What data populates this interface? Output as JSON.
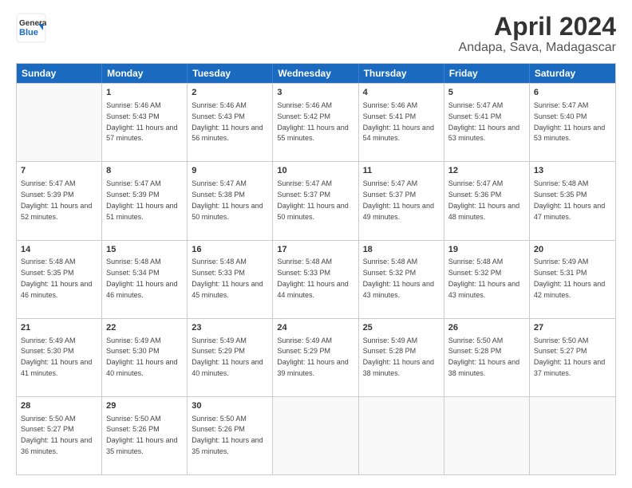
{
  "header": {
    "logo_general": "General",
    "logo_blue": "Blue",
    "month": "April 2024",
    "location": "Andapa, Sava, Madagascar"
  },
  "days_of_week": [
    "Sunday",
    "Monday",
    "Tuesday",
    "Wednesday",
    "Thursday",
    "Friday",
    "Saturday"
  ],
  "weeks": [
    [
      {
        "day": "",
        "empty": true
      },
      {
        "day": "1",
        "sunrise": "5:46 AM",
        "sunset": "5:43 PM",
        "daylight": "11 hours and 57 minutes."
      },
      {
        "day": "2",
        "sunrise": "5:46 AM",
        "sunset": "5:43 PM",
        "daylight": "11 hours and 56 minutes."
      },
      {
        "day": "3",
        "sunrise": "5:46 AM",
        "sunset": "5:42 PM",
        "daylight": "11 hours and 55 minutes."
      },
      {
        "day": "4",
        "sunrise": "5:46 AM",
        "sunset": "5:41 PM",
        "daylight": "11 hours and 54 minutes."
      },
      {
        "day": "5",
        "sunrise": "5:47 AM",
        "sunset": "5:41 PM",
        "daylight": "11 hours and 53 minutes."
      },
      {
        "day": "6",
        "sunrise": "5:47 AM",
        "sunset": "5:40 PM",
        "daylight": "11 hours and 53 minutes."
      }
    ],
    [
      {
        "day": "7",
        "sunrise": "5:47 AM",
        "sunset": "5:39 PM",
        "daylight": "11 hours and 52 minutes."
      },
      {
        "day": "8",
        "sunrise": "5:47 AM",
        "sunset": "5:39 PM",
        "daylight": "11 hours and 51 minutes."
      },
      {
        "day": "9",
        "sunrise": "5:47 AM",
        "sunset": "5:38 PM",
        "daylight": "11 hours and 50 minutes."
      },
      {
        "day": "10",
        "sunrise": "5:47 AM",
        "sunset": "5:37 PM",
        "daylight": "11 hours and 50 minutes."
      },
      {
        "day": "11",
        "sunrise": "5:47 AM",
        "sunset": "5:37 PM",
        "daylight": "11 hours and 49 minutes."
      },
      {
        "day": "12",
        "sunrise": "5:47 AM",
        "sunset": "5:36 PM",
        "daylight": "11 hours and 48 minutes."
      },
      {
        "day": "13",
        "sunrise": "5:48 AM",
        "sunset": "5:35 PM",
        "daylight": "11 hours and 47 minutes."
      }
    ],
    [
      {
        "day": "14",
        "sunrise": "5:48 AM",
        "sunset": "5:35 PM",
        "daylight": "11 hours and 46 minutes."
      },
      {
        "day": "15",
        "sunrise": "5:48 AM",
        "sunset": "5:34 PM",
        "daylight": "11 hours and 46 minutes."
      },
      {
        "day": "16",
        "sunrise": "5:48 AM",
        "sunset": "5:33 PM",
        "daylight": "11 hours and 45 minutes."
      },
      {
        "day": "17",
        "sunrise": "5:48 AM",
        "sunset": "5:33 PM",
        "daylight": "11 hours and 44 minutes."
      },
      {
        "day": "18",
        "sunrise": "5:48 AM",
        "sunset": "5:32 PM",
        "daylight": "11 hours and 43 minutes."
      },
      {
        "day": "19",
        "sunrise": "5:48 AM",
        "sunset": "5:32 PM",
        "daylight": "11 hours and 43 minutes."
      },
      {
        "day": "20",
        "sunrise": "5:49 AM",
        "sunset": "5:31 PM",
        "daylight": "11 hours and 42 minutes."
      }
    ],
    [
      {
        "day": "21",
        "sunrise": "5:49 AM",
        "sunset": "5:30 PM",
        "daylight": "11 hours and 41 minutes."
      },
      {
        "day": "22",
        "sunrise": "5:49 AM",
        "sunset": "5:30 PM",
        "daylight": "11 hours and 40 minutes."
      },
      {
        "day": "23",
        "sunrise": "5:49 AM",
        "sunset": "5:29 PM",
        "daylight": "11 hours and 40 minutes."
      },
      {
        "day": "24",
        "sunrise": "5:49 AM",
        "sunset": "5:29 PM",
        "daylight": "11 hours and 39 minutes."
      },
      {
        "day": "25",
        "sunrise": "5:49 AM",
        "sunset": "5:28 PM",
        "daylight": "11 hours and 38 minutes."
      },
      {
        "day": "26",
        "sunrise": "5:50 AM",
        "sunset": "5:28 PM",
        "daylight": "11 hours and 38 minutes."
      },
      {
        "day": "27",
        "sunrise": "5:50 AM",
        "sunset": "5:27 PM",
        "daylight": "11 hours and 37 minutes."
      }
    ],
    [
      {
        "day": "28",
        "sunrise": "5:50 AM",
        "sunset": "5:27 PM",
        "daylight": "11 hours and 36 minutes."
      },
      {
        "day": "29",
        "sunrise": "5:50 AM",
        "sunset": "5:26 PM",
        "daylight": "11 hours and 35 minutes."
      },
      {
        "day": "30",
        "sunrise": "5:50 AM",
        "sunset": "5:26 PM",
        "daylight": "11 hours and 35 minutes."
      },
      {
        "day": "",
        "empty": true
      },
      {
        "day": "",
        "empty": true
      },
      {
        "day": "",
        "empty": true
      },
      {
        "day": "",
        "empty": true
      }
    ]
  ]
}
